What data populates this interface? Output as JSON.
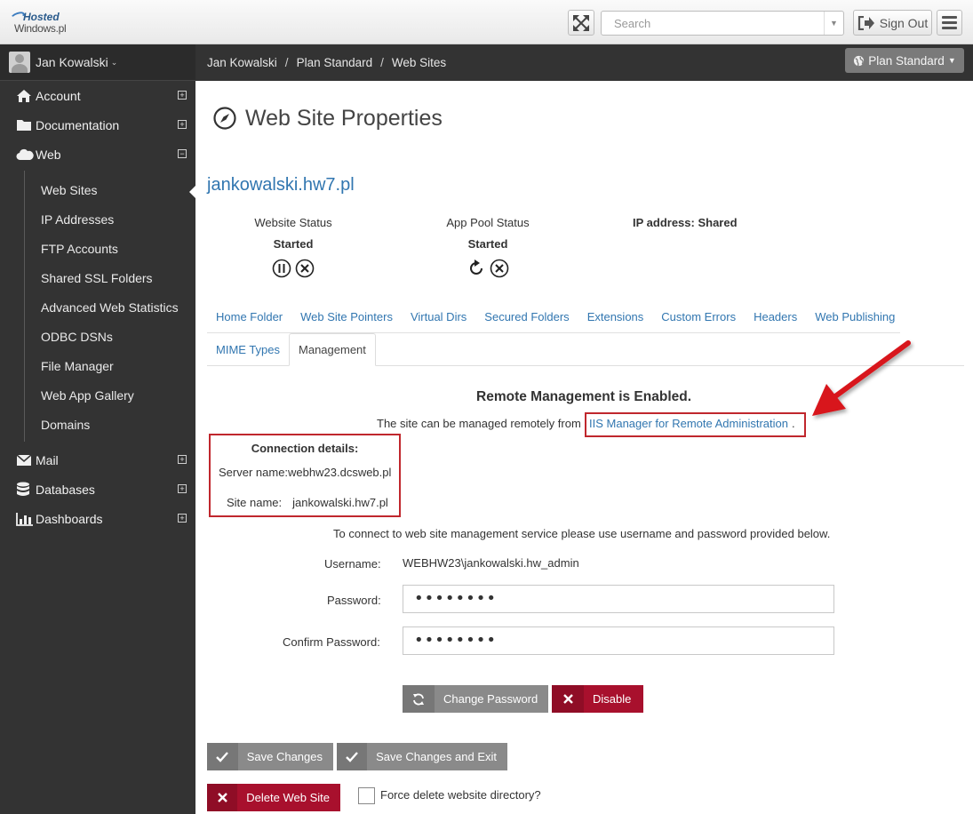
{
  "header": {
    "logo_line1": "Hosted",
    "logo_line2": "Windows.pl",
    "search_placeholder": "Search",
    "sign_out_label": "Sign Out"
  },
  "sidebar": {
    "user_name": "Jan Kowalski",
    "items": [
      {
        "label": "Account",
        "icon": "home-icon",
        "expander": "+"
      },
      {
        "label": "Documentation",
        "icon": "folder-icon",
        "expander": "+"
      },
      {
        "label": "Web",
        "icon": "cloud-icon",
        "expander": "−"
      },
      {
        "label": "Mail",
        "icon": "envelope-icon",
        "expander": "+"
      },
      {
        "label": "Databases",
        "icon": "database-icon",
        "expander": "+"
      },
      {
        "label": "Dashboards",
        "icon": "bar-chart-icon",
        "expander": "+"
      }
    ],
    "web_subitems": [
      "Web Sites",
      "IP Addresses",
      "FTP Accounts",
      "Shared SSL Folders",
      "Advanced Web Statistics",
      "ODBC DSNs",
      "File Manager",
      "Web App Gallery",
      "Domains"
    ],
    "active_subitem": "Web Sites"
  },
  "breadcrumb": {
    "items": [
      "Jan Kowalski",
      "Plan Standard",
      "Web Sites"
    ],
    "separator": "/",
    "plan_button": "Plan Standard"
  },
  "main": {
    "title": "Web Site Properties",
    "site_name": "jankowalski.hw7.pl",
    "website_status_label": "Website Status",
    "website_status_value": "Started",
    "app_pool_label": "App Pool Status",
    "app_pool_value": "Started",
    "ip_address": "IP address: Shared",
    "tabs_row1": [
      "Home Folder",
      "Web Site Pointers",
      "Virtual Dirs",
      "Secured Folders",
      "Extensions",
      "Custom Errors",
      "Headers",
      "Web Publishing"
    ],
    "tabs_row2": [
      "MIME Types",
      "Management"
    ],
    "active_tab": "Management"
  },
  "management": {
    "title": "Remote Management is Enabled.",
    "intro": "The site can be managed remotely from",
    "link": "IIS Manager for Remote Administration",
    "link_suffix": ".",
    "connection_title": "Connection details:",
    "server_label": "Server name:",
    "server_value": "webhw23.dcsweb.pl",
    "site_label": "Site name:",
    "site_value": "jankowalski.hw7.pl",
    "connect_text": "To connect to web site management service please use username and password provided below.",
    "username_label": "Username:",
    "username_value": "WEBHW23\\jankowalski.hw_admin",
    "password_label": "Password:",
    "password_value": "••••••••",
    "confirm_label": "Confirm Password:",
    "confirm_value": "••••••••",
    "change_password_label": "Change Password",
    "disable_label": "Disable"
  },
  "footer_actions": {
    "save_label": "Save Changes",
    "save_exit_label": "Save Changes and Exit",
    "delete_label": "Delete Web Site",
    "force_delete_label": "Force delete website directory?"
  },
  "colors": {
    "link": "#3176b0",
    "sidebar_bg": "#333333",
    "danger": "#a8102d",
    "highlight_box": "#c0272d"
  }
}
